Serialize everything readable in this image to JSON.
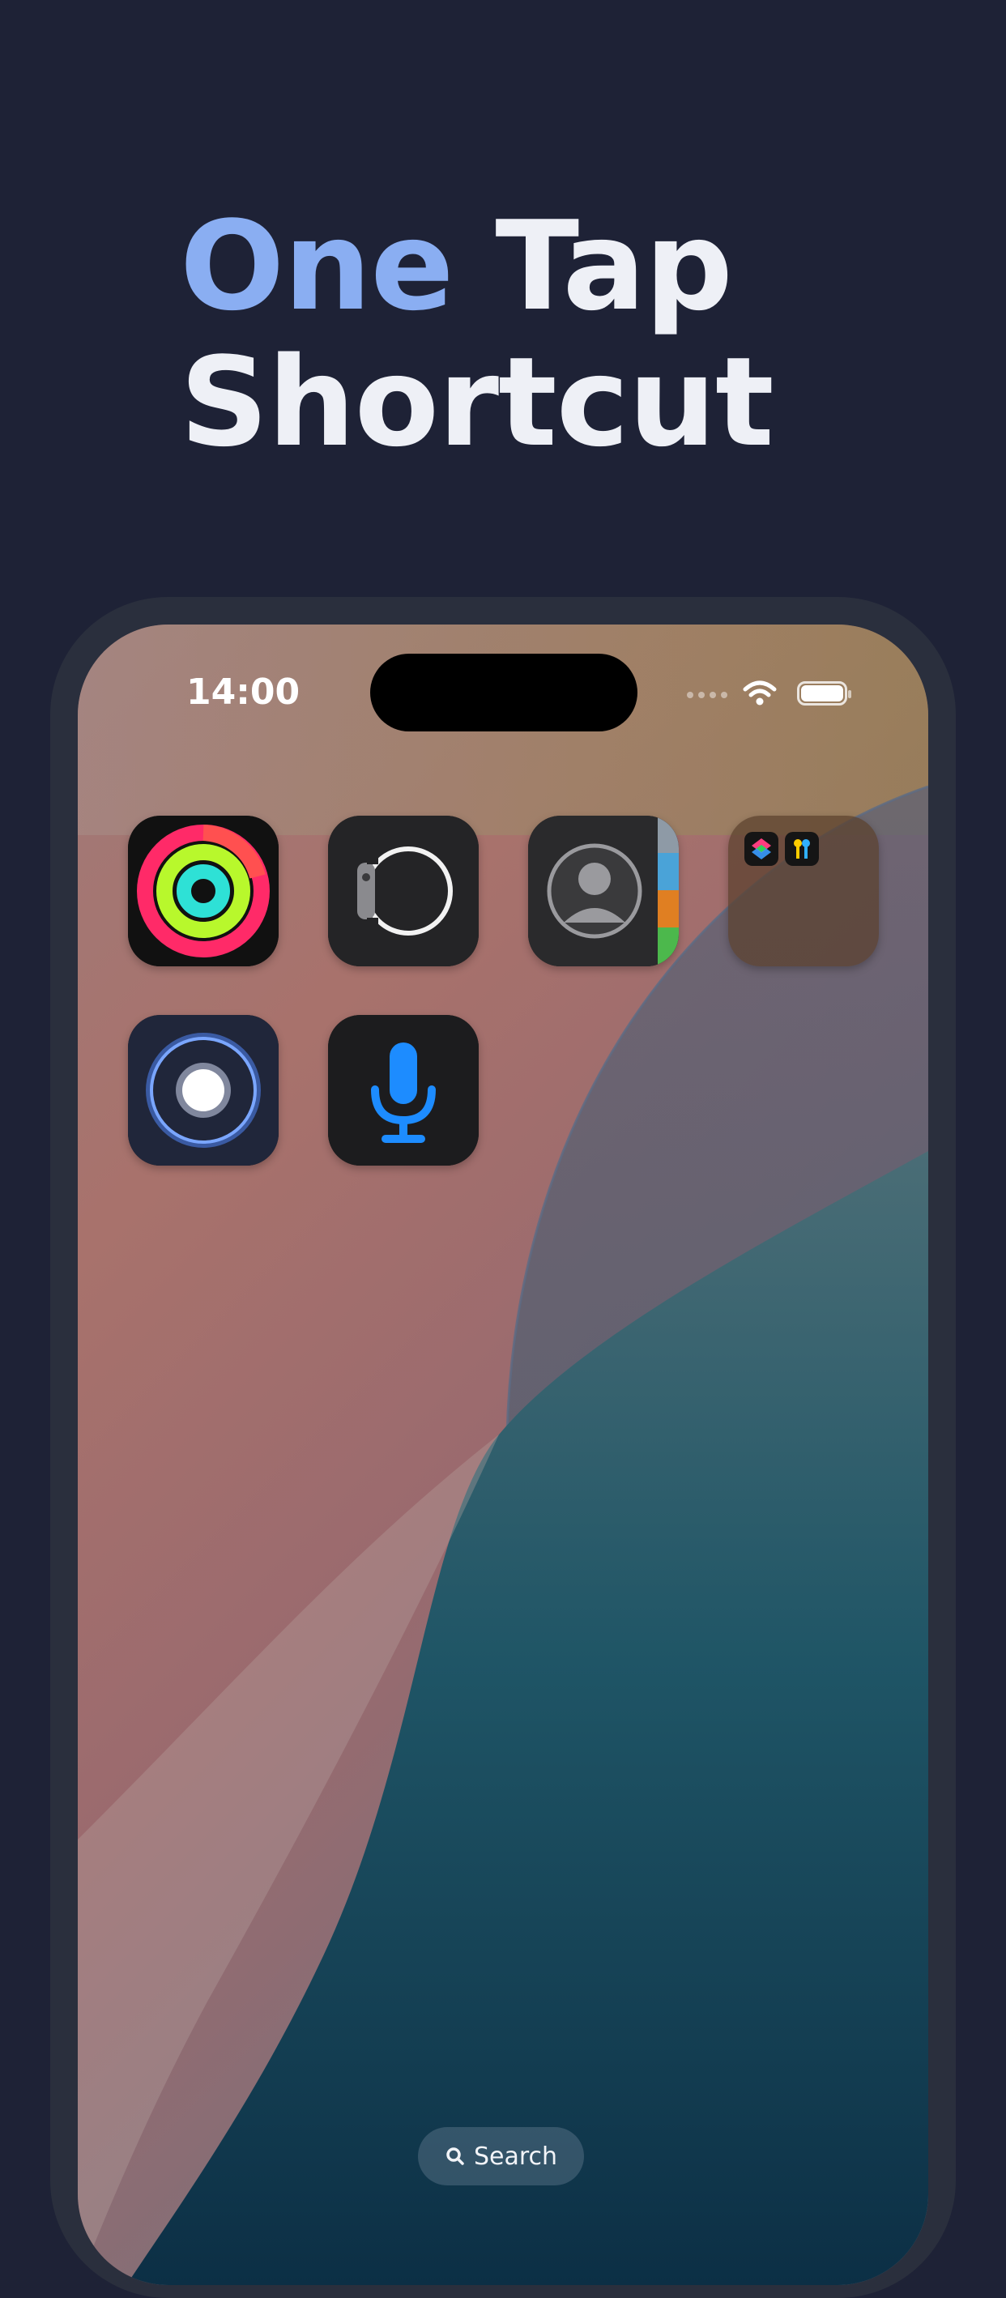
{
  "headline": {
    "line1_accent": "One",
    "line1_rest": " Tap",
    "line2": "Shortcut"
  },
  "status_bar": {
    "time": "14:00"
  },
  "apps": [
    {
      "name": "Activity",
      "icon": "activity-rings-icon"
    },
    {
      "name": "Watch",
      "icon": "apple-watch-icon"
    },
    {
      "name": "Contacts",
      "icon": "contacts-icon"
    },
    {
      "name": "Folder",
      "icon": "folder-icon",
      "contents": [
        "shortcuts-icon",
        "passwords-icon"
      ]
    },
    {
      "name": "Shazam-like record",
      "icon": "record-circle-icon"
    },
    {
      "name": "Voice",
      "icon": "microphone-icon"
    }
  ],
  "dock": {
    "search_label": "Search",
    "search_icon": "search-icon"
  },
  "colors": {
    "background": "#1e2236",
    "accent": "#8aaef2",
    "headline_text": "#eef0f6",
    "phone_frame": "#2a2f3d"
  }
}
